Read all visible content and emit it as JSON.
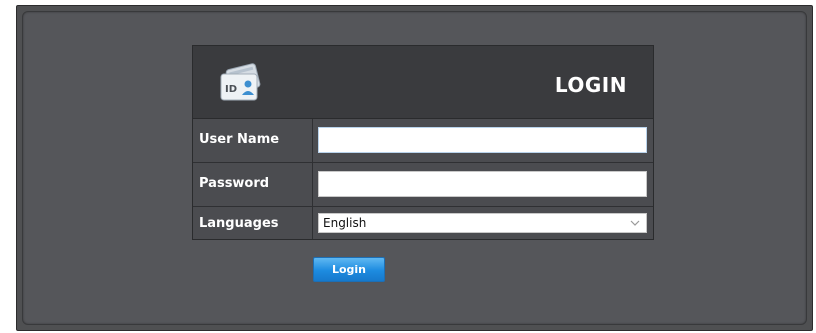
{
  "header": {
    "title": "LOGIN",
    "logo_icon": "id-card-icon",
    "logo_text": "ID"
  },
  "form": {
    "username": {
      "label": "User Name",
      "value": ""
    },
    "password": {
      "label": "Password",
      "value": ""
    },
    "languages": {
      "label": "Languages",
      "selected": "English"
    }
  },
  "actions": {
    "login_label": "Login"
  },
  "colors": {
    "background": "#55565a",
    "panel_header": "#3a3b3e",
    "button": "#1d8be0"
  }
}
